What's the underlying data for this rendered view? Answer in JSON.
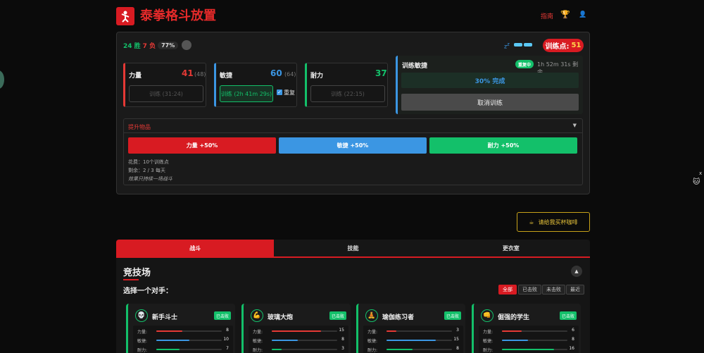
{
  "app": {
    "title": "泰拳格斗放置",
    "guide": "指南"
  },
  "header": {
    "trophy_icon": "trophy-icon",
    "user_icon": "user-icon"
  },
  "record": {
    "wins": "24 胜",
    "losses": "7 负",
    "rate": "77%"
  },
  "training_points": {
    "label": "训练点:",
    "value": "51"
  },
  "stats": [
    {
      "name": "力量",
      "value": "41",
      "max": "(48)",
      "button": "训练 (31:24)",
      "color": "#e53935"
    },
    {
      "name": "敏捷",
      "value": "60",
      "max": "(64)",
      "button": "训练 (2h 41m 29s)",
      "repeat": "重复",
      "color": "#3b96e3"
    },
    {
      "name": "耐力",
      "value": "37",
      "max": "",
      "button": "训练 (22:15)",
      "color": "#13c06a"
    }
  ],
  "training": {
    "title": "训练敏捷",
    "badge": "重复中",
    "remaining": "1h 52m 31s 剩余",
    "progress_text": "30% 完成",
    "progress": 0.3,
    "cancel": "取消训练"
  },
  "boost": {
    "title": "提升物品",
    "buttons": [
      "力量 +50%",
      "敏捷 +50%",
      "耐力 +50%"
    ],
    "cost": "花费：10个训练点",
    "remaining": "剩余：2 / 3 每天",
    "note": "效果只持续一场战斗"
  },
  "coffee": "请给我买杯咖啡",
  "tabs": [
    "战斗",
    "技能",
    "更衣室"
  ],
  "arena": {
    "title": "竞技场",
    "subtitle": "选择一个对手：",
    "filters": [
      "全部",
      "已击败",
      "未击败",
      "最近"
    ]
  },
  "opponents": [
    {
      "name": "新手斗士",
      "badge": "已击败",
      "stats": [
        {
          "label": "力量:",
          "value": 8
        },
        {
          "label": "敏捷:",
          "value": 10
        },
        {
          "label": "耐力:",
          "value": 7
        }
      ]
    },
    {
      "name": "玻璃大炮",
      "badge": "已击败",
      "stats": [
        {
          "label": "力量:",
          "value": 15
        },
        {
          "label": "敏捷:",
          "value": 8
        },
        {
          "label": "耐力:",
          "value": 3
        }
      ]
    },
    {
      "name": "瑜伽练习者",
      "badge": "已击败",
      "stats": [
        {
          "label": "力量:",
          "value": 3
        },
        {
          "label": "敏捷:",
          "value": 15
        },
        {
          "label": "耐力:",
          "value": 8
        }
      ]
    },
    {
      "name": "倔强的学生",
      "badge": "已击败",
      "stats": [
        {
          "label": "力量:",
          "value": 6
        },
        {
          "label": "敏捷:",
          "value": 8
        },
        {
          "label": "耐力:",
          "value": 16
        }
      ]
    }
  ],
  "side": {
    "close": "x"
  }
}
